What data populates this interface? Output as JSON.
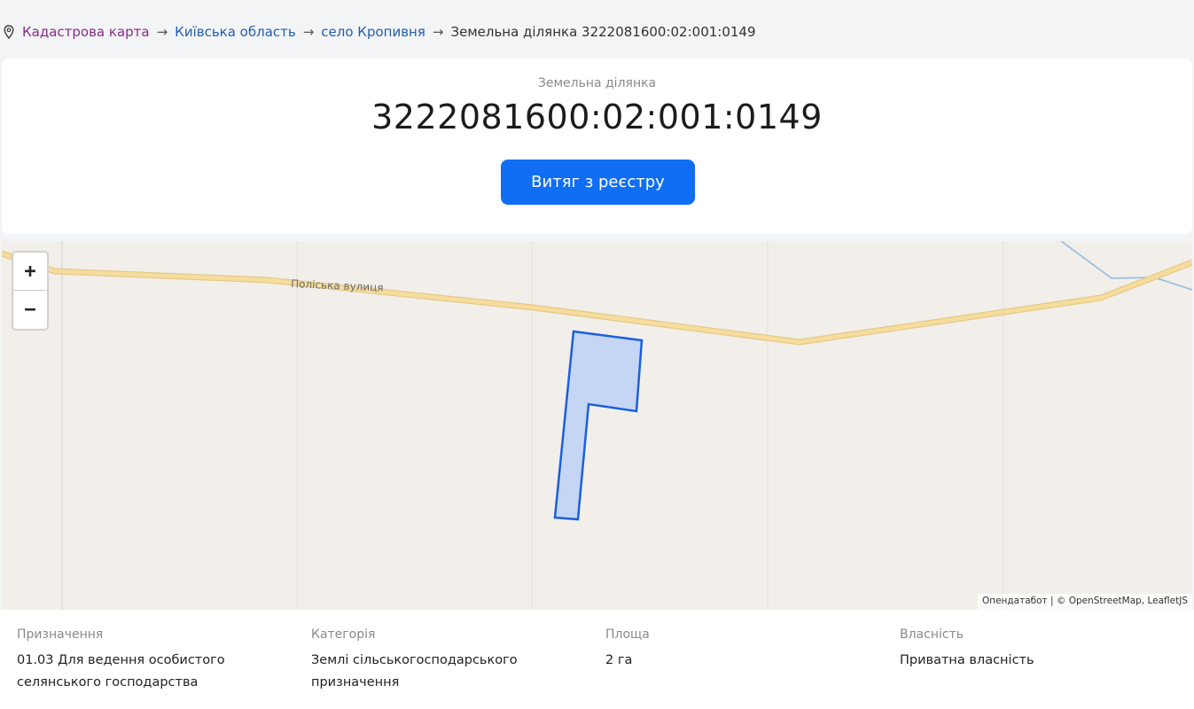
{
  "breadcrumb": {
    "items": [
      {
        "label": "Кадастрова карта"
      },
      {
        "label": "Київська область"
      },
      {
        "label": "село Кропивня"
      }
    ],
    "separator": "→",
    "current": "Земельна ділянка 3222081600:02:001:0149"
  },
  "header": {
    "subtitle": "Земельна ділянка",
    "title": "3222081600:02:001:0149",
    "extract_button": "Витяг з реєстру"
  },
  "map": {
    "street_label": "Поліська вулиця",
    "zoom_in": "+",
    "zoom_out": "−",
    "attribution": "Опендатабот | © OpenStreetMap, LeafletJS",
    "parcel_color": "#1a5fe0"
  },
  "details": {
    "purpose": {
      "label": "Призначення",
      "value_line1": "01.03 Для ведення особистого",
      "value_line2": "селянського господарства"
    },
    "category": {
      "label": "Категорія",
      "value_line1": "Землі сільськогосподарського",
      "value_line2": "призначення"
    },
    "area": {
      "label": "Площа",
      "value_line1": "2 га"
    },
    "ownership": {
      "label": "Власність",
      "value_line1": "Приватна власність"
    }
  }
}
